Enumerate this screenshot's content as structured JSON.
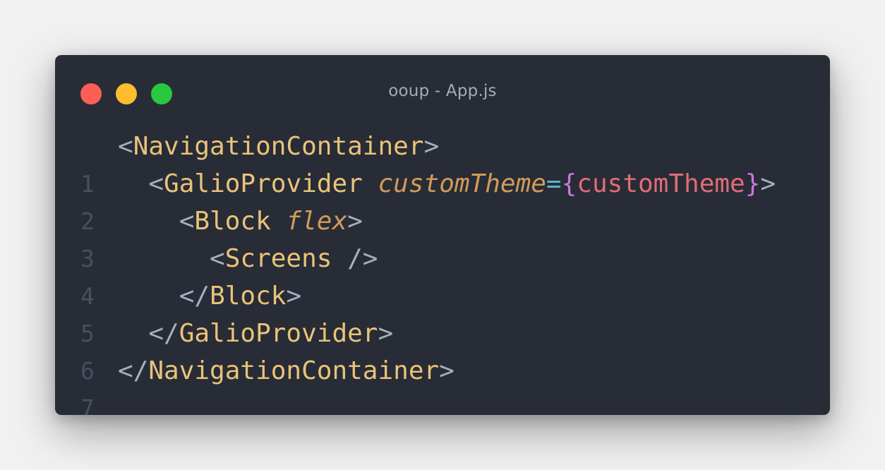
{
  "window": {
    "title": "ooup - App.js"
  },
  "code": {
    "lines": [
      {
        "number": "1",
        "indent": "",
        "open": "<",
        "tag": "NavigationContainer",
        "close": ">"
      },
      {
        "number": "2",
        "indent": "  ",
        "open": "<",
        "tag": "GalioProvider",
        "space": " ",
        "attr": "customTheme",
        "eq": "=",
        "brace_open": "{",
        "expr": "customTheme",
        "brace_close": "}",
        "close": ">"
      },
      {
        "number": "3",
        "indent": "    ",
        "open": "<",
        "tag": "Block",
        "space": " ",
        "attr": "flex",
        "close": ">"
      },
      {
        "number": "4",
        "indent": "      ",
        "open": "<",
        "tag": "Screens",
        "close": " />"
      },
      {
        "number": "5",
        "indent": "    ",
        "open": "</",
        "tag": "Block",
        "close": ">"
      },
      {
        "number": "6",
        "indent": "  ",
        "open": "</",
        "tag": "GalioProvider",
        "close": ">"
      },
      {
        "number": "7",
        "indent": "",
        "open": "</",
        "tag": "NavigationContainer",
        "close": ">"
      }
    ]
  },
  "colors": {
    "background": "#f1f1f1",
    "window": "#282c36",
    "close_dot": "#fd5f57",
    "minimize_dot": "#febc2e",
    "zoom_dot": "#28c840",
    "tag": "#e9c37a",
    "attribute": "#d29a5a",
    "expression": "#e06c75",
    "brace": "#c678dd",
    "punctuation": "#a7b0c0",
    "line_number": "#4a4f5e"
  }
}
